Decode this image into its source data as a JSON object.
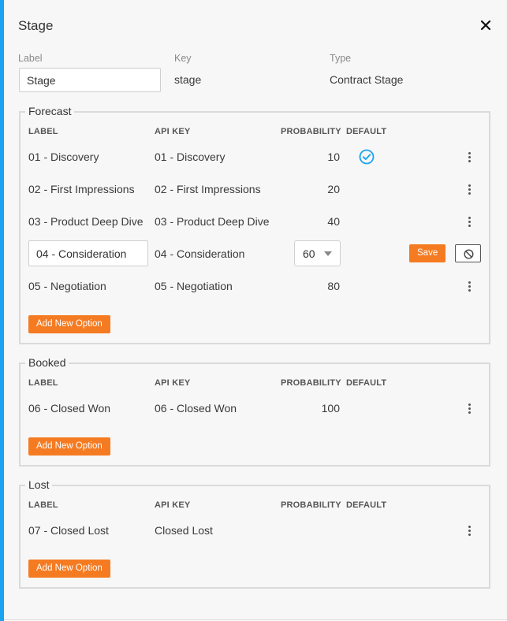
{
  "dialog": {
    "title": "Stage",
    "close_icon": "close-icon"
  },
  "meta": {
    "label_caption": "Label",
    "label_value": "Stage",
    "key_caption": "Key",
    "key_value": "stage",
    "type_caption": "Type",
    "type_value": "Contract Stage"
  },
  "columns": {
    "label": "LABEL",
    "api_key": "API KEY",
    "probability": "PROBABILITY",
    "default": "DEFAULT"
  },
  "forecast": {
    "title": "Forecast",
    "rows": [
      {
        "label": "01 - Discovery",
        "api_key": "01 - Discovery",
        "probability": "10",
        "default": true
      },
      {
        "label": "02 - First Impressions",
        "api_key": "02 - First Impressions",
        "probability": "20",
        "default": false
      },
      {
        "label": "03 - Product Deep Dive",
        "api_key": "03 - Product Deep Dive",
        "probability": "40",
        "default": false
      },
      {
        "label": "05 - Negotiation",
        "api_key": "05 - Negotiation",
        "probability": "80",
        "default": false
      }
    ],
    "editing_row": {
      "label_value": "04 - Consideration",
      "api_key": "04 - Consideration",
      "probability_selected": "60",
      "save_label": "Save"
    },
    "add_label": "Add New Option"
  },
  "booked": {
    "title": "Booked",
    "rows": [
      {
        "label": "06 - Closed Won",
        "api_key": "06 - Closed Won",
        "probability": "100"
      }
    ],
    "add_label": "Add New Option"
  },
  "lost": {
    "title": "Lost",
    "rows": [
      {
        "label": "07 - Closed Lost",
        "api_key": "Closed Lost",
        "probability": ""
      }
    ],
    "add_label": "Add New Option"
  },
  "colors": {
    "accent": "#1aa3f0",
    "button": "#f57b22",
    "check": "#1aa3f0"
  }
}
